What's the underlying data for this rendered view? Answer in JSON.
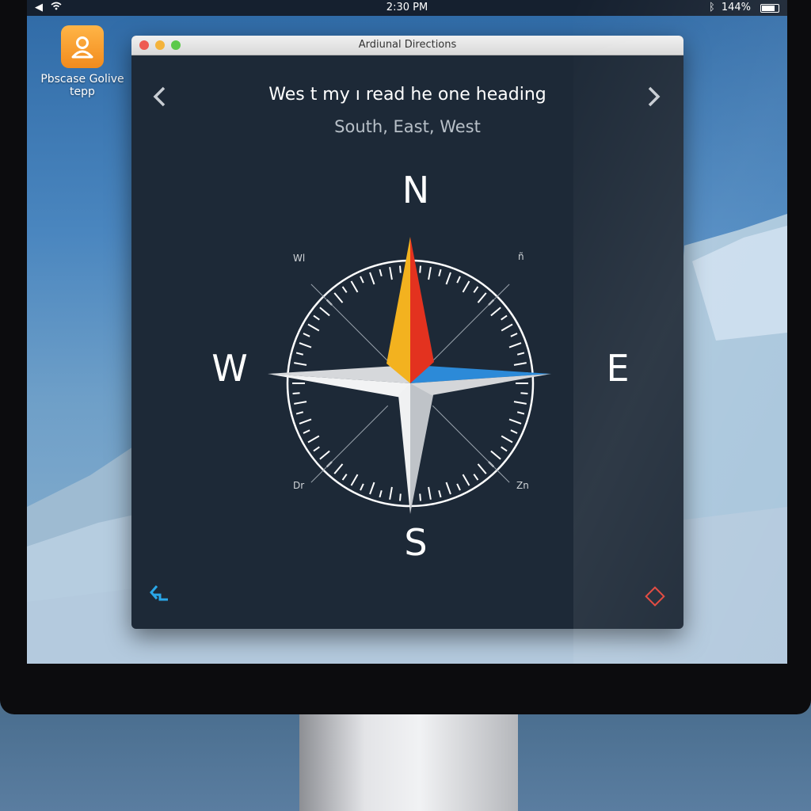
{
  "menubar": {
    "time": "2:30 PM",
    "battery": "144%"
  },
  "desktop": {
    "app_label": "Pbscase Golive tepp"
  },
  "window": {
    "title": "Ardiunal Directions",
    "heading": "Wes t my ı read he one heading",
    "subheading": "South, East,  West"
  },
  "compass": {
    "north": "N",
    "south": "S",
    "east": "E",
    "west": "W",
    "nw_label": "Wl",
    "ne_label": "ñ",
    "sw_label": "Dr",
    "se_label": "Zn"
  },
  "colors": {
    "window_bg": "#1d2937",
    "needle_yellow": "#f3b21f",
    "needle_red": "#e3321f",
    "needle_blue": "#2c8ad8",
    "back_icon": "#2aa7e8",
    "diamond_icon": "#e2443a"
  },
  "icons": {
    "menubar_left": [
      "back-arrow-icon",
      "wifi-icon"
    ],
    "menubar_right": [
      "bluetooth-icon",
      "battery-icon"
    ],
    "nav_left": "chevron-left-icon",
    "nav_right": "chevron-right-icon",
    "bottom_left": "back-icon",
    "bottom_right": "diamond-icon"
  }
}
